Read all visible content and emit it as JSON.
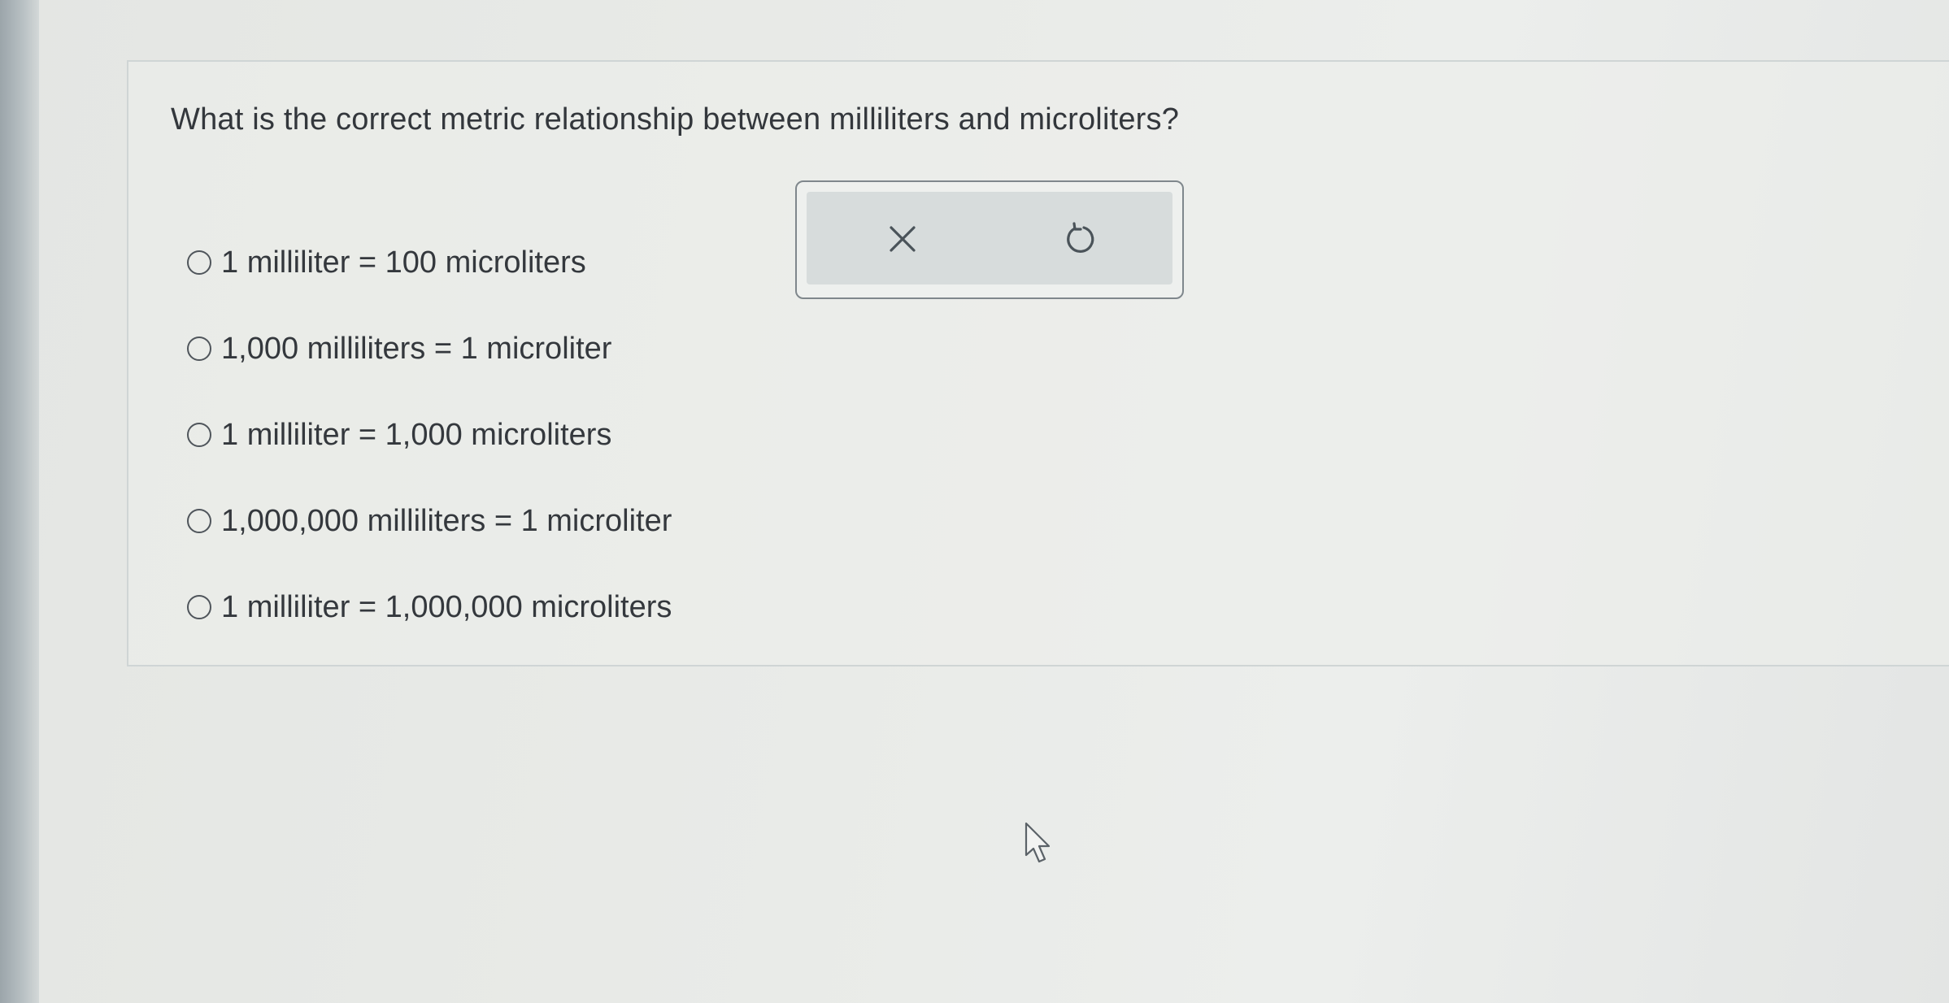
{
  "question": {
    "text": "What is the correct metric relationship between milliliters and microliters?"
  },
  "options": [
    {
      "label": "1 milliliter = 100 microliters",
      "selected": false
    },
    {
      "label": "1,000 milliliters = 1 microliter",
      "selected": false
    },
    {
      "label": "1 milliliter = 1,000 microliters",
      "selected": false
    },
    {
      "label": "1,000,000 milliliters = 1 microliter",
      "selected": false
    },
    {
      "label": "1 milliliter = 1,000,000 microliters",
      "selected": false
    }
  ],
  "actions": {
    "clear_icon": "close-icon",
    "reset_icon": "undo-icon"
  },
  "colors": {
    "text": "#33373c",
    "radio_border": "#4f555b",
    "action_bg": "#d7dcdc",
    "icon": "#4a5359"
  }
}
